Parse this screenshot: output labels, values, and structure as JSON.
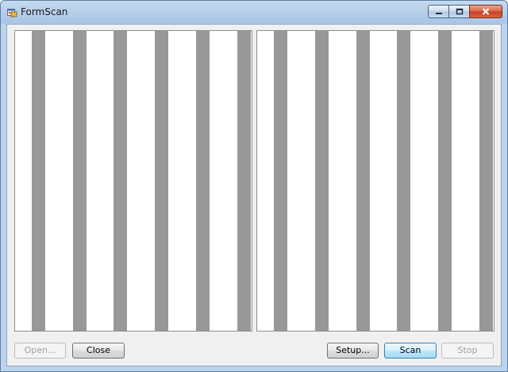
{
  "window": {
    "title": "FormScan",
    "icon": "app-window-icon"
  },
  "caption_buttons": {
    "minimize_icon": "minimize-icon",
    "maximize_icon": "maximize-icon",
    "close_icon": "close-icon"
  },
  "panels": {
    "left": {
      "name": "left-image-panel"
    },
    "right": {
      "name": "right-image-panel"
    }
  },
  "buttons": {
    "open": {
      "label": "Open...",
      "enabled": false
    },
    "close": {
      "label": "Close",
      "enabled": true
    },
    "setup": {
      "label": "Setup...",
      "enabled": true
    },
    "scan": {
      "label": "Scan",
      "enabled": true,
      "default": true
    },
    "stop": {
      "label": "Stop",
      "enabled": false
    }
  },
  "colors": {
    "stripe": "#989898",
    "panel_bg": "#ffffff",
    "client_bg": "#f0f0f0",
    "titlebar": "#b7cfea",
    "close_button": "#c6402a"
  }
}
